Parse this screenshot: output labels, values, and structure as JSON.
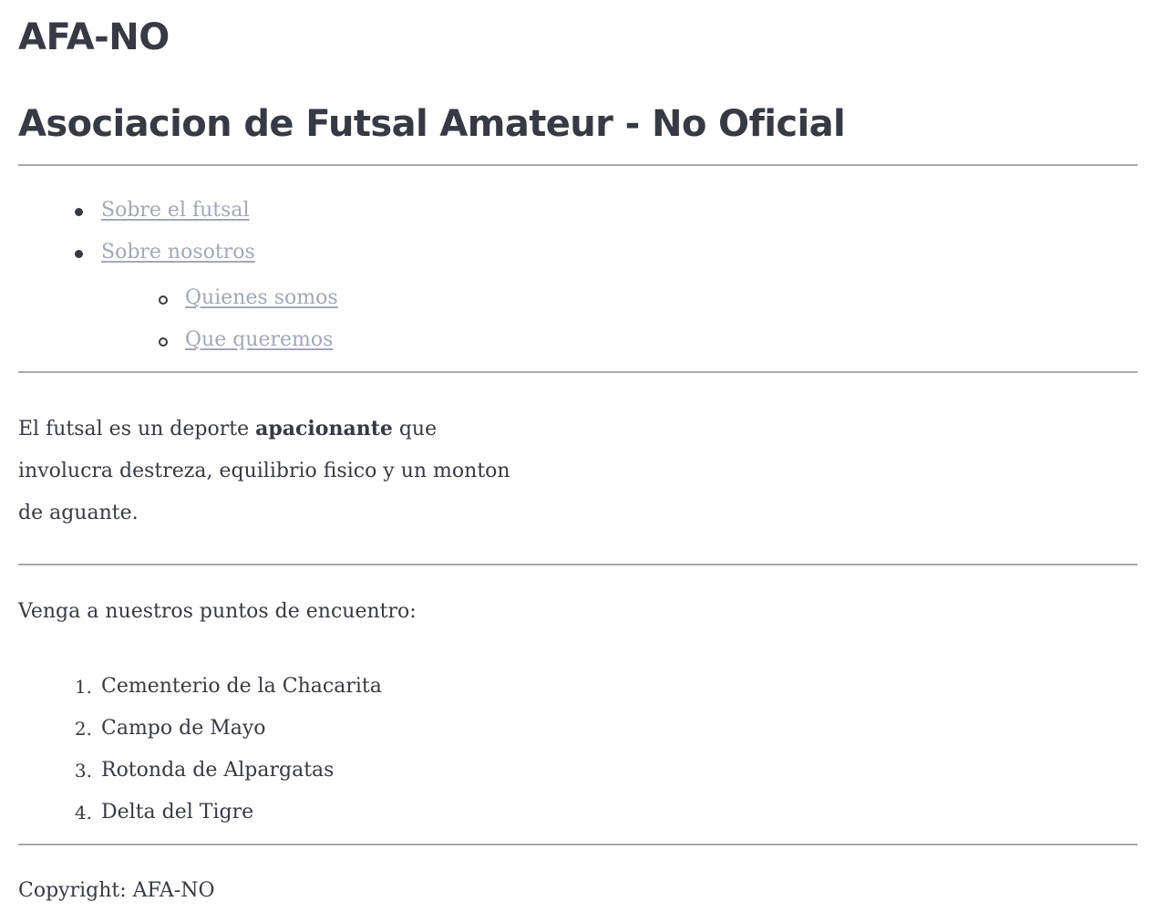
{
  "header": {
    "site_name": "AFA-NO",
    "site_title": "Asociacion de Futsal Amateur - No Oficial"
  },
  "nav": {
    "items": [
      {
        "label": "Sobre el futsal"
      },
      {
        "label": "Sobre nosotros"
      }
    ],
    "subitems": [
      {
        "label": "Quienes somos"
      },
      {
        "label": "Que queremos"
      }
    ]
  },
  "intro": {
    "text_before": "El futsal es un deporte ",
    "emphasis": "apacionante",
    "text_after": " que involucra destreza, equilibrio fisico y un monton de aguante."
  },
  "meeting": {
    "heading": "Venga a nuestros puntos de encuentro:",
    "places": [
      {
        "num": "1.",
        "label": "Cementerio de la Chacarita"
      },
      {
        "num": "2.",
        "label": "Campo de Mayo"
      },
      {
        "num": "3.",
        "label": "Rotonda de Alpargatas"
      },
      {
        "num": "4.",
        "label": "Delta del Tigre"
      }
    ]
  },
  "footer": {
    "copyright": "Copyright: AFA-NO"
  },
  "colors": {
    "text": "#373a44",
    "link": "#a1a8b8",
    "rule": "#a9a9a9",
    "background": "#ffffff"
  }
}
